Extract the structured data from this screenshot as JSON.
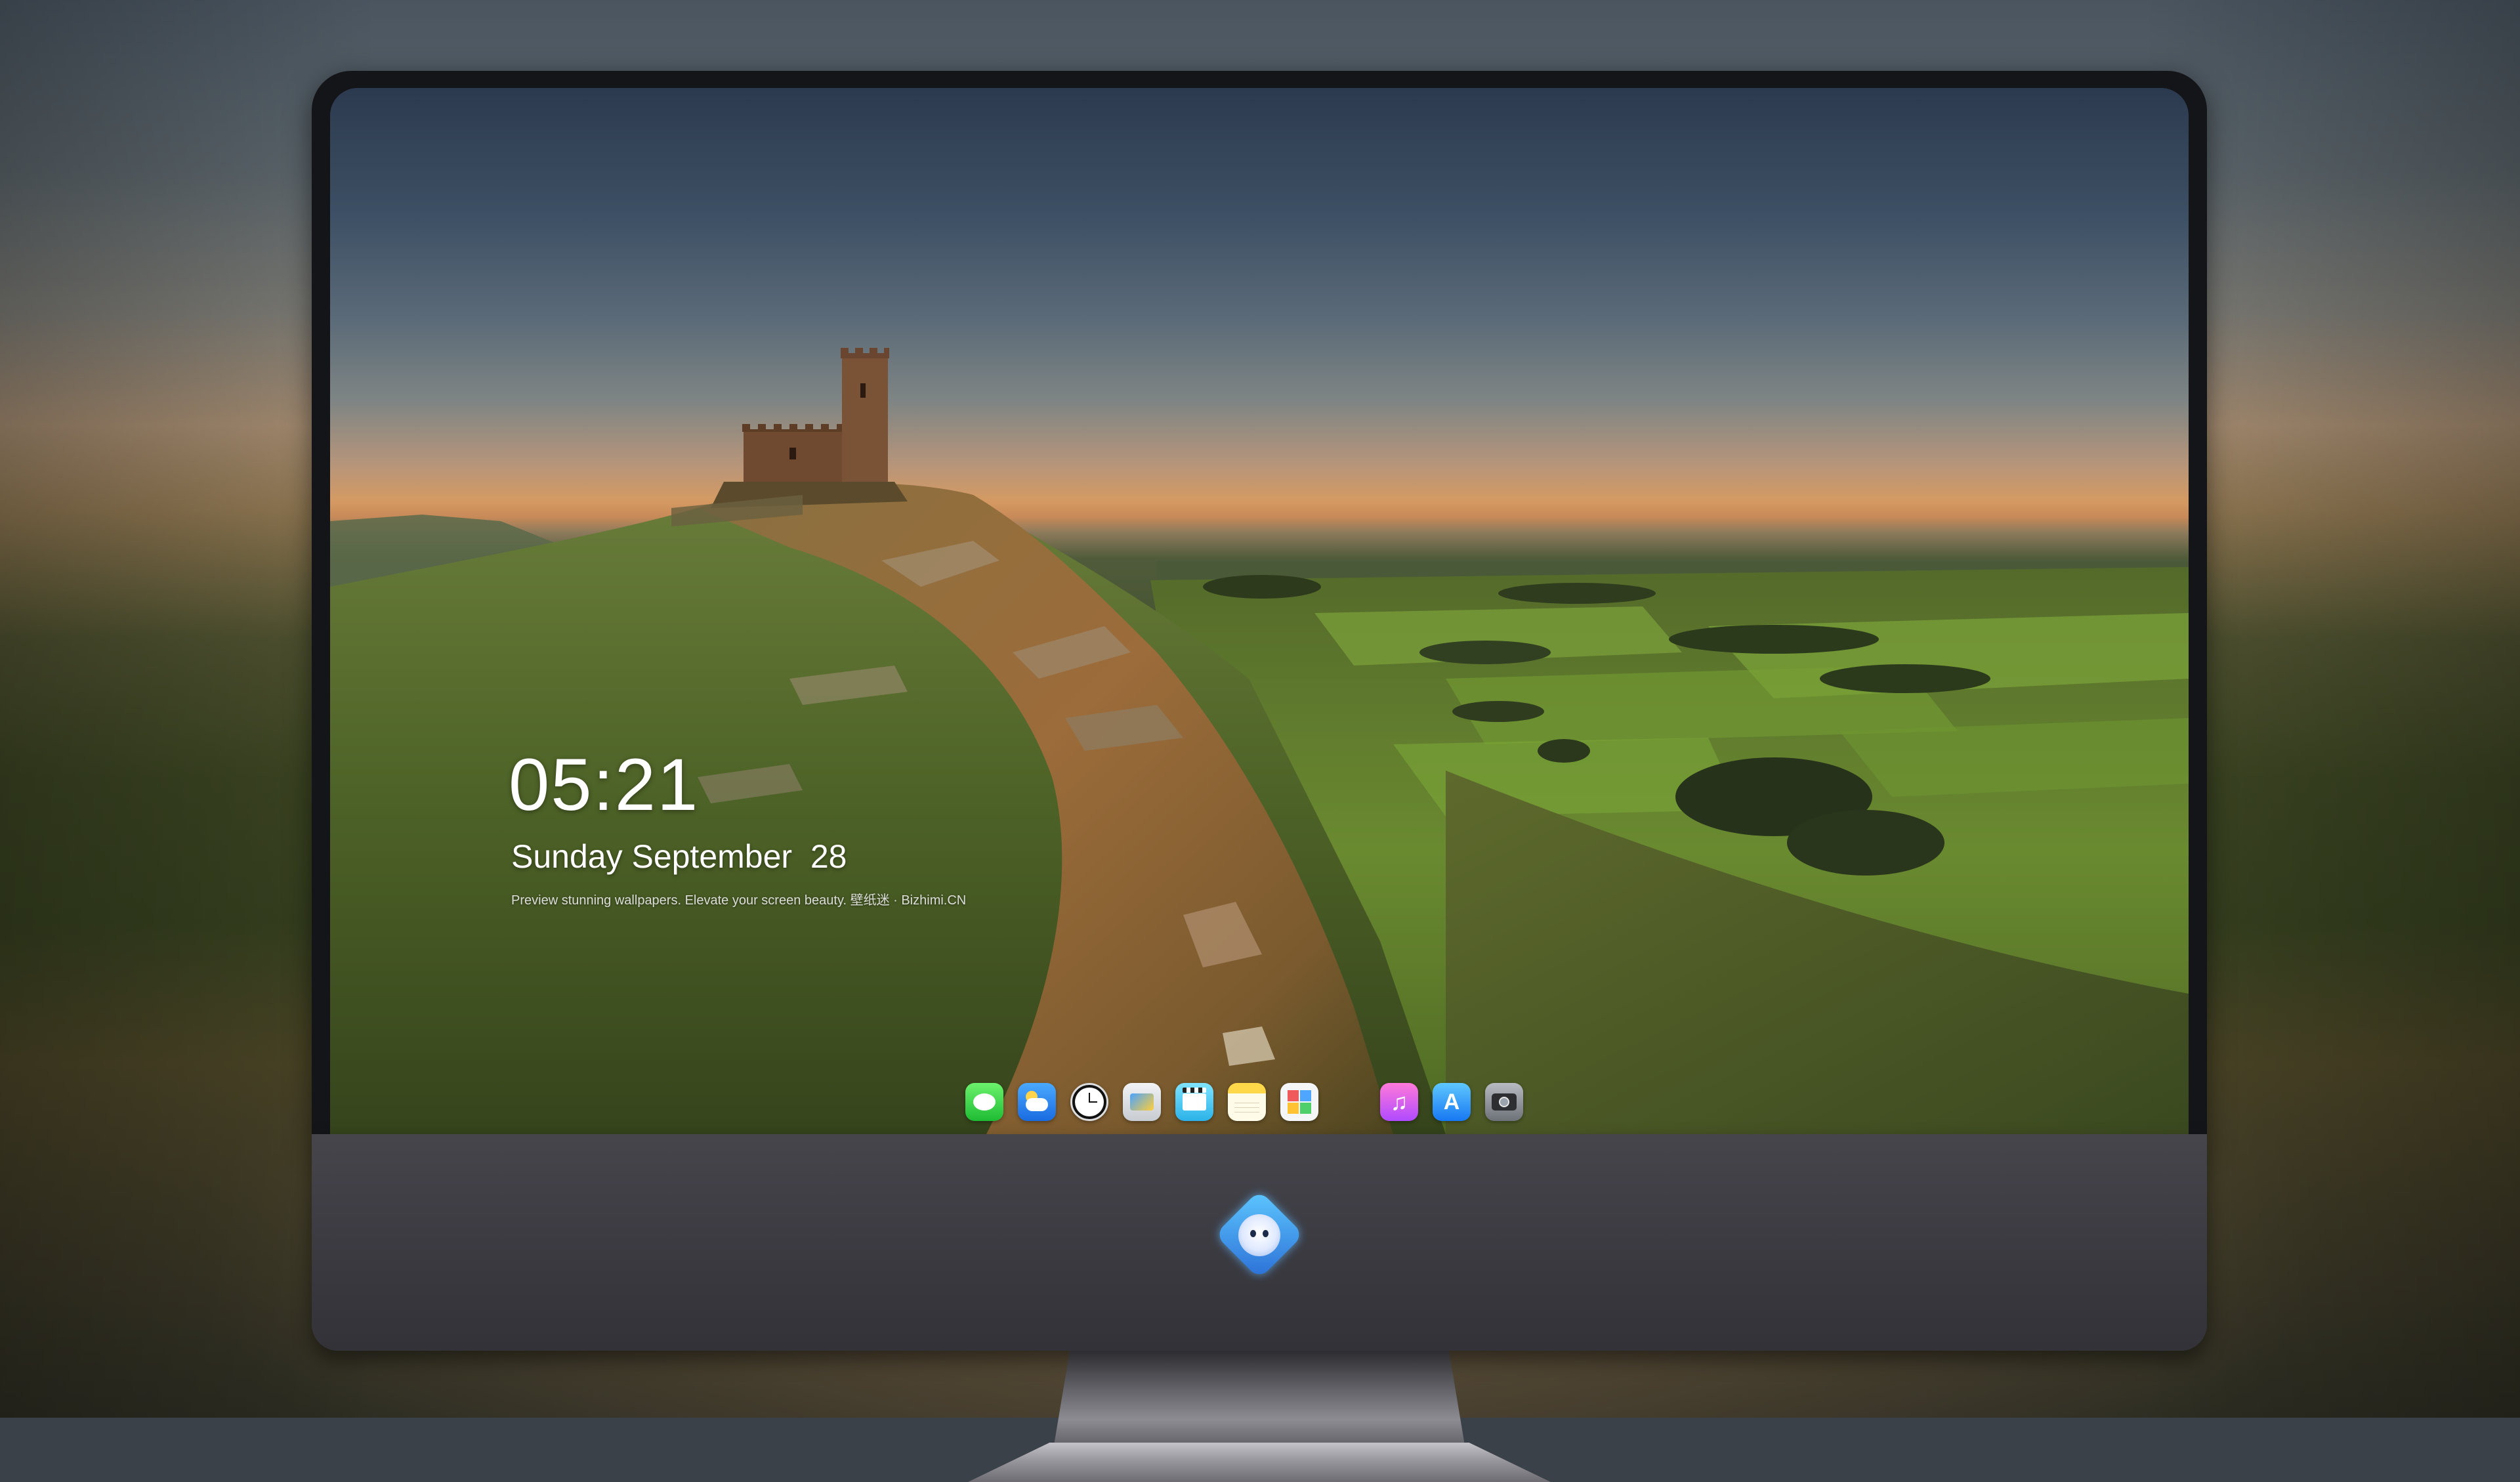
{
  "lock_screen": {
    "time": "05:21",
    "date": "Sunday September  28",
    "tagline": "Preview stunning wallpapers. Elevate your screen beauty. 壁纸迷 · Bizhimi.CN"
  },
  "dock": {
    "apps": [
      {
        "icon": "messages-icon"
      },
      {
        "icon": "weather-icon"
      },
      {
        "icon": "clock-icon"
      },
      {
        "icon": "preview-icon"
      },
      {
        "icon": "video-icon"
      },
      {
        "icon": "notes-icon"
      },
      {
        "icon": "photos-icon"
      },
      {
        "icon": "music-icon",
        "glyph": "♫"
      },
      {
        "icon": "app-store-icon",
        "glyph": "A"
      },
      {
        "icon": "camera-icon"
      }
    ]
  },
  "monitor": {
    "logo_icon": "dragon-mascot-logo-icon"
  },
  "colors": {
    "sky_top": "#2c3a4f",
    "horizon_glow": "#d59a62",
    "grass": "#4e6a2c",
    "bezel": "#141518",
    "chin": "#3f3e45"
  }
}
